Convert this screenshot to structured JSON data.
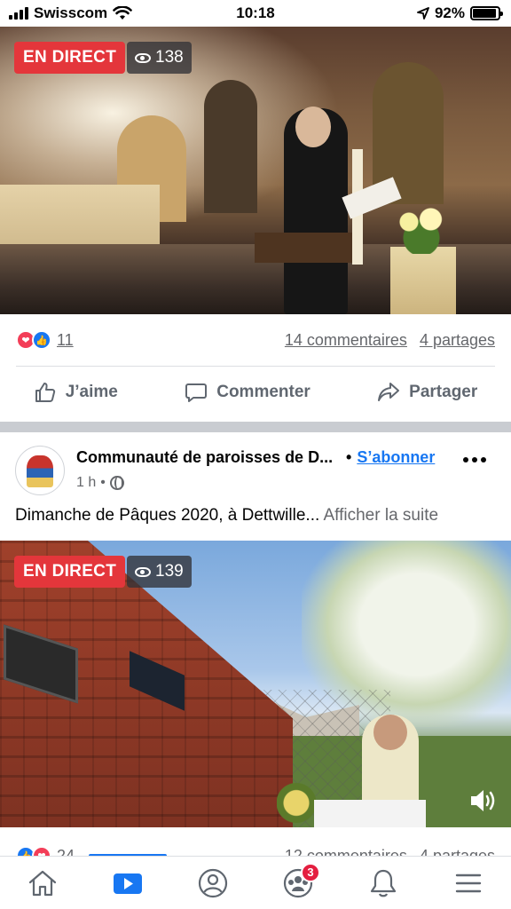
{
  "status_bar": {
    "carrier": "Swisscom",
    "time": "10:18",
    "battery_percent": "92%",
    "battery_level": 0.92
  },
  "video1": {
    "live_label": "EN DIRECT",
    "viewers": "138"
  },
  "post1_stats": {
    "reactions_count": "11",
    "comments": "14 commentaires",
    "shares": "4 partages"
  },
  "actions": {
    "like": "J’aime",
    "comment": "Commenter",
    "share": "Partager"
  },
  "post2": {
    "page_name": "Communauté de paroisses de D...",
    "follow": "S’abonner",
    "separator": "•",
    "time": "1 h",
    "meta_dot": "•",
    "text": "Dimanche de Pâques 2020, à Dettwille...",
    "see_more": " Afficher la suite"
  },
  "video2": {
    "live_label": "EN DIRECT",
    "viewers": "139"
  },
  "post2_stats": {
    "reactions_count": "24",
    "comments": "12 commentaires",
    "shares": "4 partages"
  },
  "tabbar": {
    "icons": [
      "home-icon",
      "watch-icon",
      "profile-icon",
      "groups-icon",
      "notifications-icon",
      "menu-icon"
    ],
    "groups_badge": "3",
    "active_tab": "watch"
  },
  "colors": {
    "facebook_blue": "#1877f2",
    "live_red": "#e4363b",
    "badge_red": "#e41e3f",
    "secondary_text": "#65676b"
  }
}
